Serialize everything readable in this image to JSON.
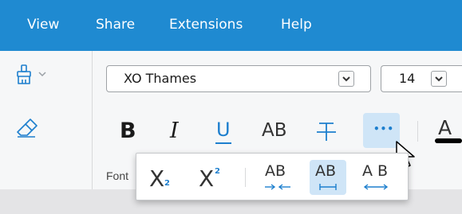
{
  "menubar": {
    "items": [
      "View",
      "Share",
      "Extensions",
      "Help"
    ]
  },
  "ribbon": {
    "font_family": "XO Thames",
    "font_size": "14",
    "group_label": "Font",
    "buttons": {
      "bold": "B",
      "italic": "I",
      "underline": "U",
      "allcaps": "AB",
      "more": "•••",
      "font_color": "A"
    },
    "font_color": "#000000"
  },
  "popup": {
    "subscript": "X",
    "subscript_mark": "2",
    "superscript": "X",
    "superscript_mark": "2",
    "spacing_condensed": "AB",
    "spacing_normal": "AB",
    "spacing_expanded": "A B"
  },
  "colors": {
    "accent": "#1f8ad1",
    "icon_blue": "#1d7fce",
    "active_bg": "#cfe5f7",
    "text": "#1a1a1a"
  }
}
